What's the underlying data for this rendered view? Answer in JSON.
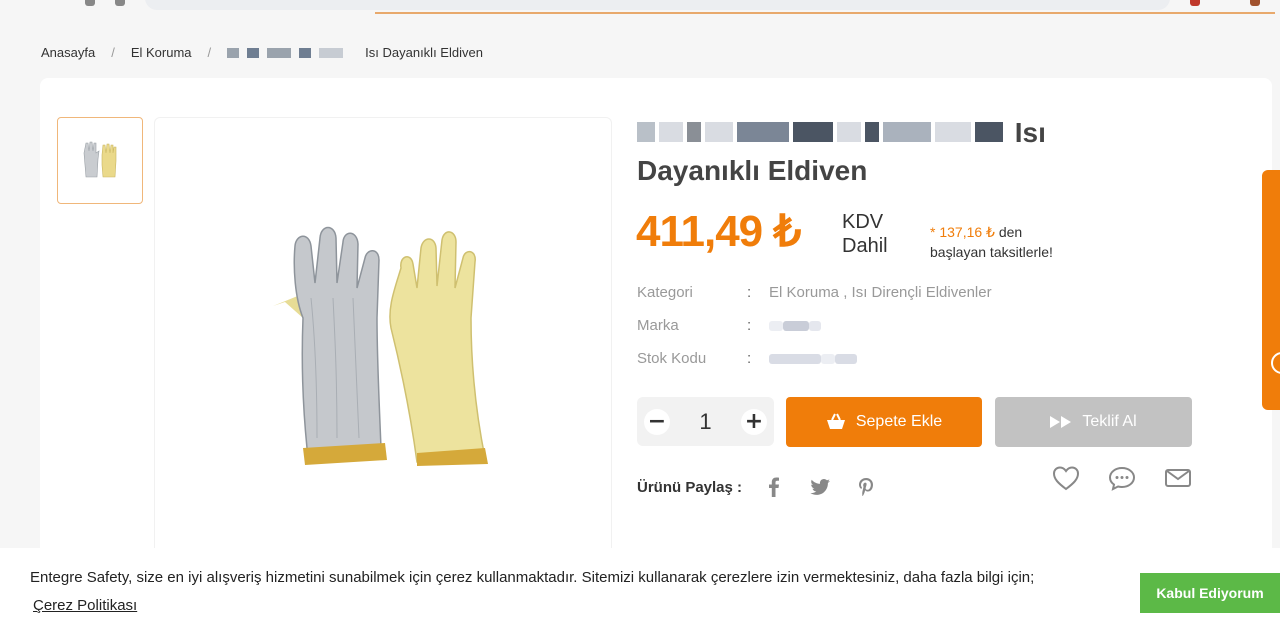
{
  "breadcrumb": {
    "home": "Anasayfa",
    "category": "El Koruma",
    "current": "Isı Dayanıklı Eldiven"
  },
  "product": {
    "title_visible": "Isı",
    "title_line2": "Dayanıklı Eldiven",
    "price": "411,49 ₺",
    "tax_line1": "KDV",
    "tax_line2": "Dahil",
    "installment_amount": "* 137,16 ₺",
    "installment_suffix": " den",
    "installment_line2": "başlayan taksitlerle!",
    "meta": {
      "category_label": "Kategori",
      "category_value": "El Koruma , Isı Dirençli Eldivenler",
      "brand_label": "Marka",
      "stock_label": "Stok Kodu",
      "colon": ":"
    },
    "quantity": "1",
    "add_to_cart": "Sepete Ekle",
    "get_offer": "Teklif Al",
    "share_label": "Ürünü Paylaş :"
  },
  "cookie": {
    "text": "Entegre Safety, size en iyi alışveriş hizmetini sunabilmek için çerez kullanmaktadır. Sitemizi kullanarak çerezlere izin vermektesiniz, daha fazla bilgi için;",
    "link": "Çerez Politikası",
    "accept": "Kabul Ediyorum"
  },
  "colors": {
    "accent": "#f07d0a",
    "offer_button": "#c2c2c2",
    "cookie_button": "#5cb947"
  },
  "icons": [
    "facebook-icon",
    "twitter-icon",
    "pinterest-icon",
    "heart-icon",
    "comment-icon",
    "mail-icon",
    "basket-icon",
    "fast-forward-icon"
  ]
}
